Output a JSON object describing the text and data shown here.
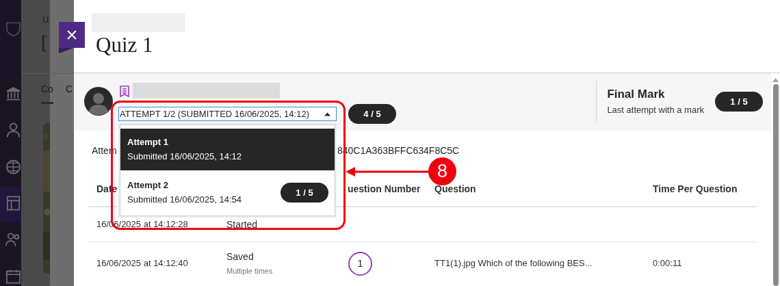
{
  "background_page": {
    "header_texts": [
      "U",
      "["
    ],
    "tabs": [
      {
        "label": "Co",
        "selected": true
      },
      {
        "label": "C",
        "selected": false
      }
    ]
  },
  "panel": {
    "title": "Quiz 1",
    "attempt_selector": {
      "value": "ATTEMPT 1/2 (SUBMITTED 16/06/2025, 14:12)",
      "expanded": true,
      "options": [
        {
          "title": "Attempt 1",
          "subtitle": "Submitted 16/06/2025, 14:12",
          "selected": true
        },
        {
          "title": "Attempt 2",
          "subtitle": "Submitted 16/06/2025, 14:54",
          "selected": false,
          "mark": "1 / 5"
        }
      ]
    },
    "attempt_mark": "4 / 5",
    "final_mark": {
      "title": "Final Mark",
      "subtitle": "Last attempt with a mark",
      "mark": "1 / 5"
    },
    "attempt_id": {
      "left": "Attem",
      "right": "840C1A363BFFC634F8C5C"
    },
    "table": {
      "columns": {
        "date": "Date",
        "question_number": "uestion Number",
        "question": "Question",
        "time": "Time Per Question"
      },
      "rows": [
        {
          "date": "16/06/2025 at 14:12:28",
          "column_2": "Started"
        },
        {
          "date": "16/06/2025 at 14:12:40",
          "column_2": "Saved",
          "column_2_note": "Multiple times",
          "question_number": "1",
          "question": "TT1(1).jpg Which of the following BES...",
          "time": "0:00:11"
        }
      ]
    }
  },
  "annotation": {
    "number": "8"
  }
}
